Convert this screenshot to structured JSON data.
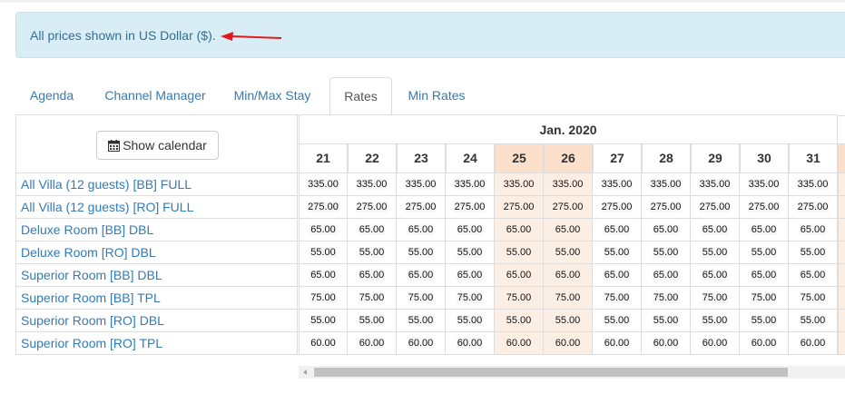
{
  "notice": {
    "text": "All prices shown in US Dollar ($)."
  },
  "tabs": [
    {
      "label": "Agenda"
    },
    {
      "label": "Channel Manager"
    },
    {
      "label": "Min/Max Stay"
    },
    {
      "label": "Rates",
      "active": true
    },
    {
      "label": "Min Rates"
    }
  ],
  "calendar_button": {
    "label": "Show calendar",
    "icon": "calendar-icon"
  },
  "month": "Jan. 2020",
  "days": [
    {
      "day": "21",
      "weekend": false
    },
    {
      "day": "22",
      "weekend": false
    },
    {
      "day": "23",
      "weekend": false
    },
    {
      "day": "24",
      "weekend": false
    },
    {
      "day": "25",
      "weekend": true
    },
    {
      "day": "26",
      "weekend": true
    },
    {
      "day": "27",
      "weekend": false
    },
    {
      "day": "28",
      "weekend": false
    },
    {
      "day": "29",
      "weekend": false
    },
    {
      "day": "30",
      "weekend": false
    },
    {
      "day": "31",
      "weekend": false
    }
  ],
  "rooms": [
    {
      "name": "All Villa (12 guests) [BB] FULL",
      "rates": [
        "335.00",
        "335.00",
        "335.00",
        "335.00",
        "335.00",
        "335.00",
        "335.00",
        "335.00",
        "335.00",
        "335.00",
        "335.00"
      ]
    },
    {
      "name": "All Villa (12 guests) [RO] FULL",
      "rates": [
        "275.00",
        "275.00",
        "275.00",
        "275.00",
        "275.00",
        "275.00",
        "275.00",
        "275.00",
        "275.00",
        "275.00",
        "275.00"
      ]
    },
    {
      "name": "Deluxe Room [BB] DBL",
      "rates": [
        "65.00",
        "65.00",
        "65.00",
        "65.00",
        "65.00",
        "65.00",
        "65.00",
        "65.00",
        "65.00",
        "65.00",
        "65.00"
      ]
    },
    {
      "name": "Deluxe Room [RO] DBL",
      "rates": [
        "55.00",
        "55.00",
        "55.00",
        "55.00",
        "55.00",
        "55.00",
        "55.00",
        "55.00",
        "55.00",
        "55.00",
        "55.00"
      ]
    },
    {
      "name": "Superior Room [BB] DBL",
      "rates": [
        "65.00",
        "65.00",
        "65.00",
        "65.00",
        "65.00",
        "65.00",
        "65.00",
        "65.00",
        "65.00",
        "65.00",
        "65.00"
      ]
    },
    {
      "name": "Superior Room [BB] TPL",
      "rates": [
        "75.00",
        "75.00",
        "75.00",
        "75.00",
        "75.00",
        "75.00",
        "75.00",
        "75.00",
        "75.00",
        "75.00",
        "75.00"
      ]
    },
    {
      "name": "Superior Room [RO] DBL",
      "rates": [
        "55.00",
        "55.00",
        "55.00",
        "55.00",
        "55.00",
        "55.00",
        "55.00",
        "55.00",
        "55.00",
        "55.00",
        "55.00"
      ]
    },
    {
      "name": "Superior Room [RO] TPL",
      "rates": [
        "60.00",
        "60.00",
        "60.00",
        "60.00",
        "60.00",
        "60.00",
        "60.00",
        "60.00",
        "60.00",
        "60.00",
        "60.00"
      ]
    }
  ],
  "colors": {
    "link": "#337ab7",
    "weekend_header": "#fde0cc",
    "alert_bg": "#d9edf7",
    "arrow": "#e01b1b"
  }
}
